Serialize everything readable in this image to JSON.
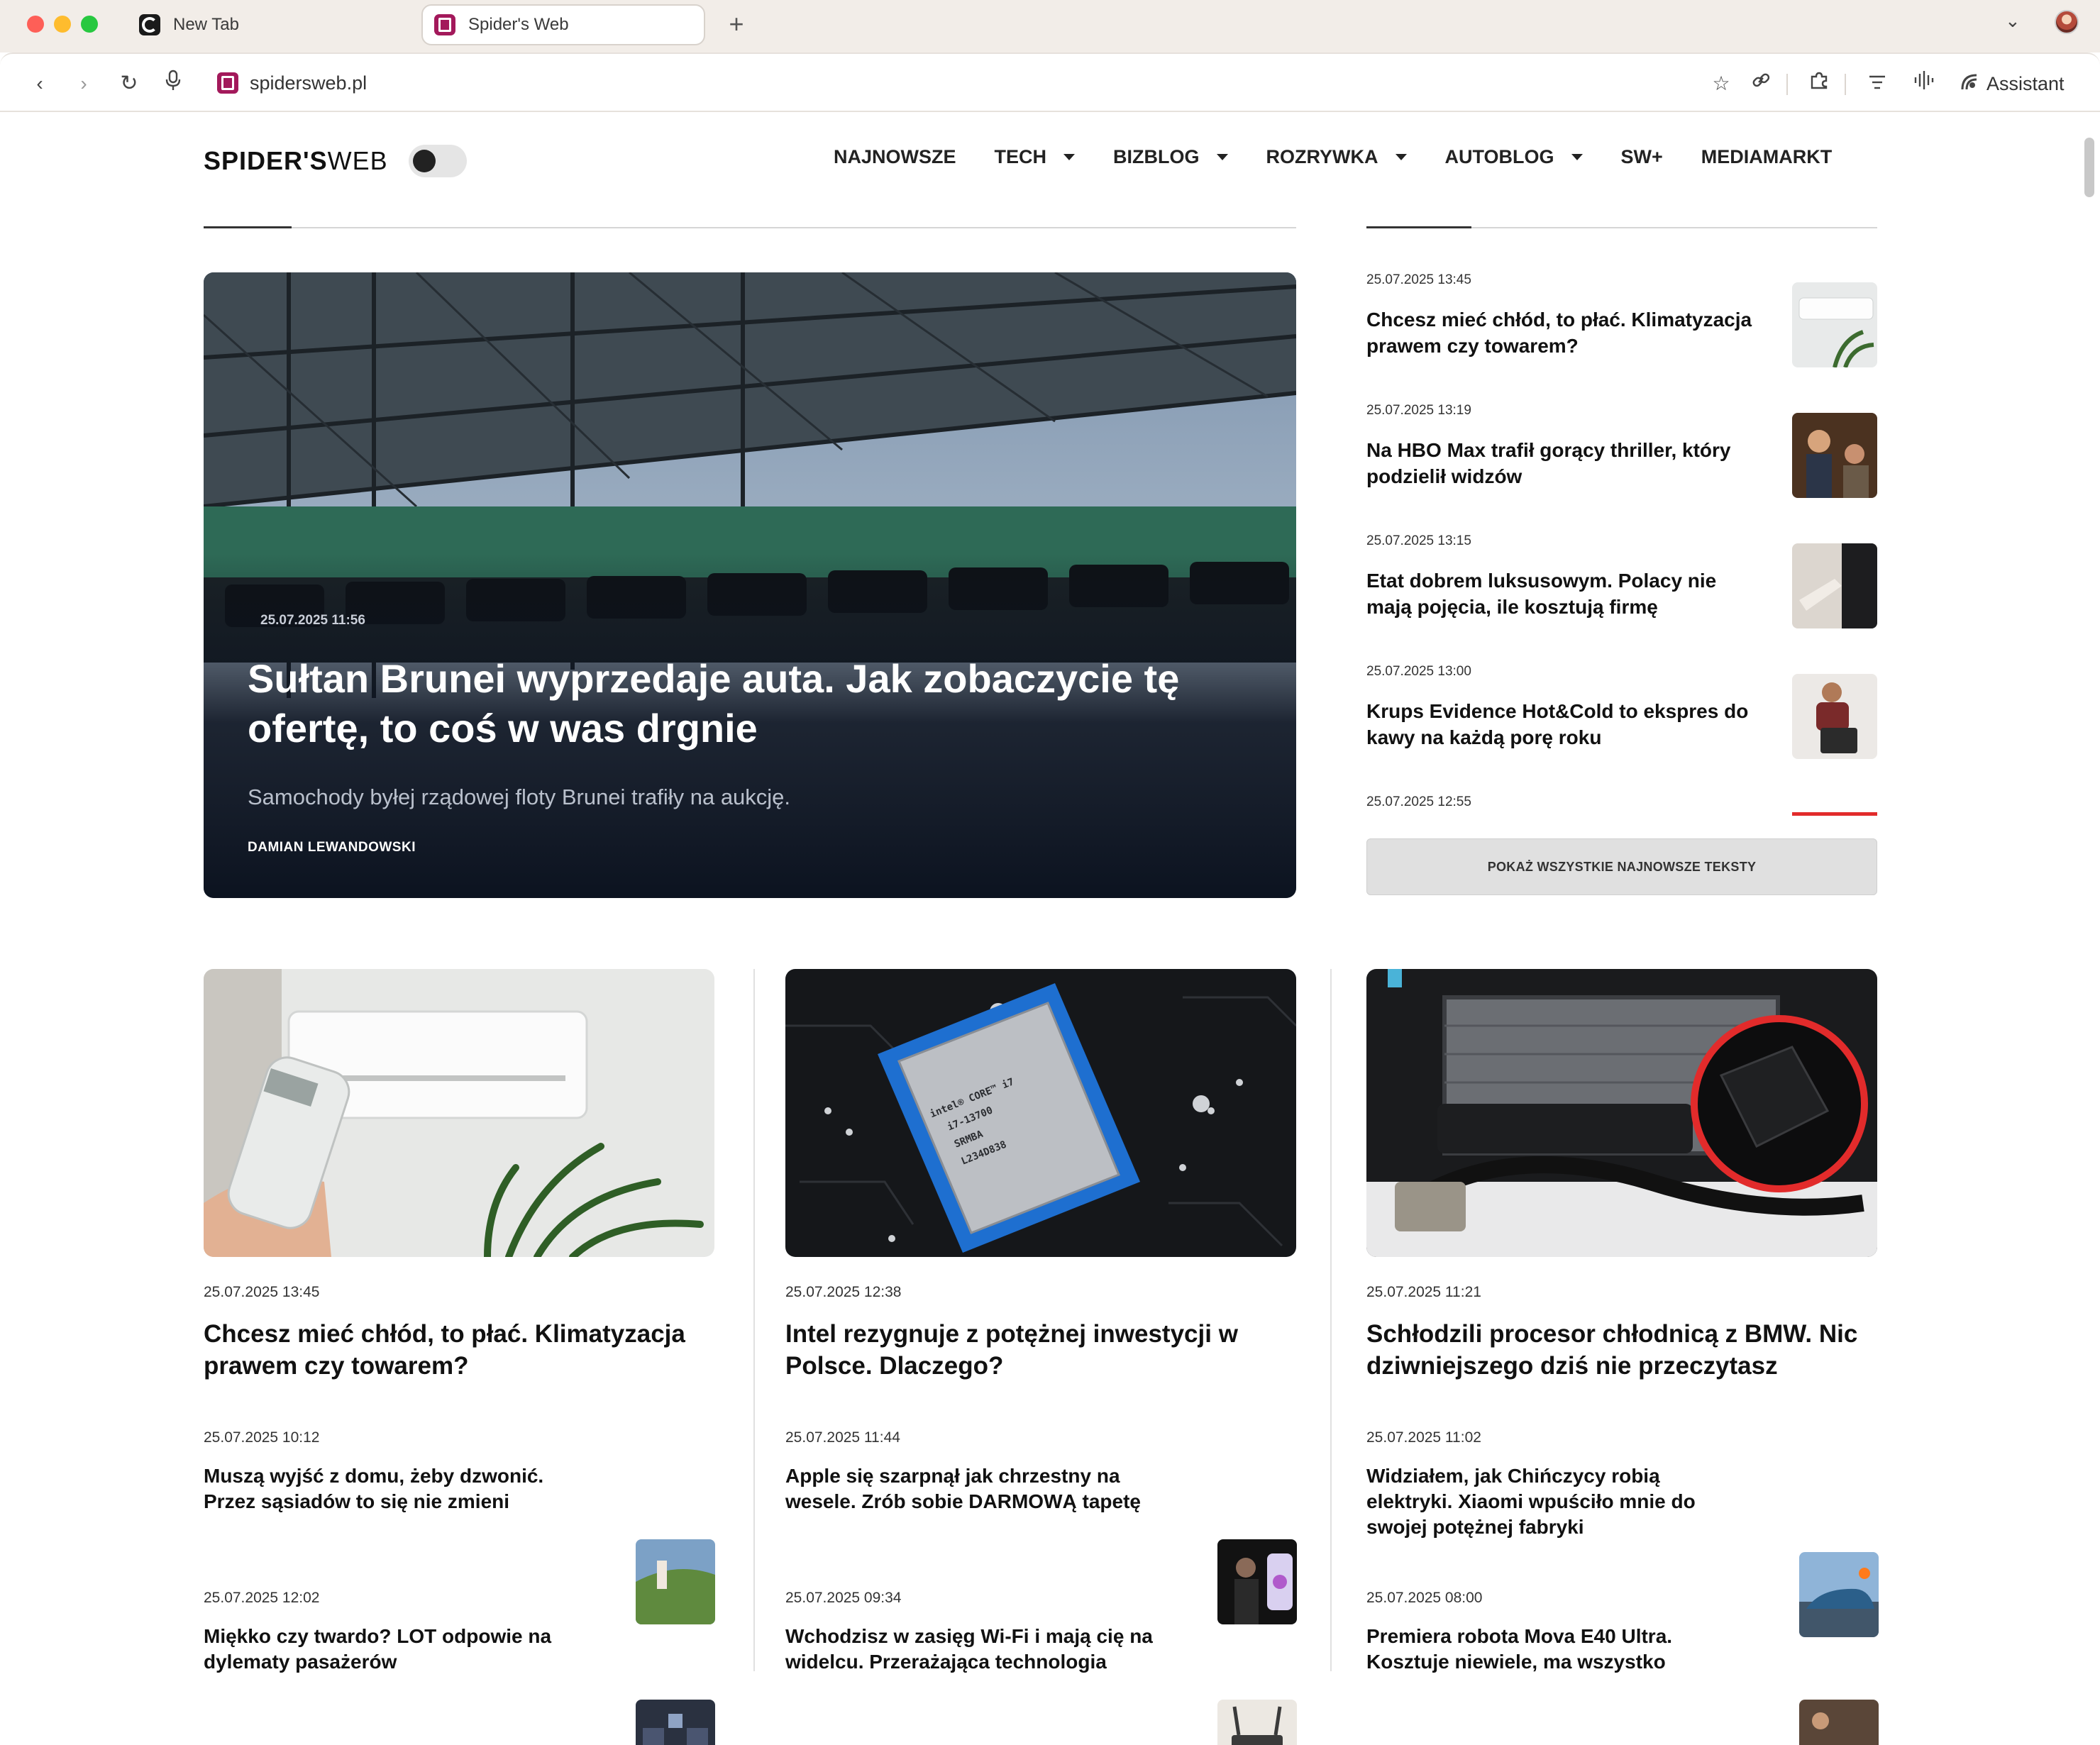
{
  "browser": {
    "tabs": [
      {
        "title": "New Tab",
        "active": false
      },
      {
        "title": "Spider's Web",
        "active": true
      }
    ],
    "url": "spidersweb.pl",
    "assistant_label": "Assistant"
  },
  "site": {
    "logo_bold": "SPIDER'S",
    "logo_light": "WEB",
    "nav": [
      {
        "label": "NAJNOWSZE",
        "dropdown": false
      },
      {
        "label": "TECH",
        "dropdown": true
      },
      {
        "label": "BIZBLOG",
        "dropdown": true
      },
      {
        "label": "ROZRYWKA",
        "dropdown": true
      },
      {
        "label": "AUTOBLOG",
        "dropdown": true
      },
      {
        "label": "SW+",
        "dropdown": false
      },
      {
        "label": "MEDIAMARKT",
        "dropdown": false
      }
    ]
  },
  "hero": {
    "date": "25.07.2025 11:56",
    "title": "Sułtan Brunei wyprzedaje auta. Jak zobaczycie tę ofertę, to coś w was drgnie",
    "lead": "Samochody byłej rządowej floty Brunei trafiły na aukcję.",
    "author": "DAMIAN LEWANDOWSKI"
  },
  "latest": {
    "items": [
      {
        "date": "25.07.2025 13:45",
        "title": "Chcesz mieć chłód, to płać. Klimatyzacja prawem czy towarem?"
      },
      {
        "date": "25.07.2025 13:19",
        "title": "Na HBO Max trafił gorący thriller, który podzielił widzów"
      },
      {
        "date": "25.07.2025 13:15",
        "title": "Etat dobrem luksusowym. Polacy nie mają pojęcia, ile kosztują firmę"
      },
      {
        "date": "25.07.2025 13:00",
        "title": "Krups Evidence Hot&Cold to ekspres do kawy na każdą porę roku"
      },
      {
        "date": "25.07.2025 12:55",
        "title": ""
      }
    ],
    "show_all": "POKAŻ WSZYSTKIE NAJNOWSZE TEKSTY"
  },
  "columns": [
    {
      "main": {
        "date": "25.07.2025 13:45",
        "title": "Chcesz mieć chłód, to płać. Klimatyzacja prawem czy towarem?"
      },
      "items": [
        {
          "date": "25.07.2025 10:12",
          "title": "Muszą wyjść z domu, żeby dzwonić. Przez sąsiadów to się nie zmieni"
        },
        {
          "date": "25.07.2025 12:02",
          "title": "Miękko czy twardo? LOT odpowie na dylematy pasażerów"
        }
      ]
    },
    {
      "main": {
        "date": "25.07.2025 12:38",
        "title": "Intel rezygnuje z potężnej inwestycji w Polsce. Dlaczego?"
      },
      "items": [
        {
          "date": "25.07.2025 11:44",
          "title": "Apple się szarpnął jak chrzestny na wesele. Zrób sobie DARMOWĄ tapetę"
        },
        {
          "date": "25.07.2025 09:34",
          "title": "Wchodzisz w zasięg Wi-Fi i mają cię na widelcu. Przerażająca technologia"
        }
      ]
    },
    {
      "main": {
        "date": "25.07.2025 11:21",
        "title": "Schłodzili procesor chłodnicą z BMW. Nic dziwniejszego dziś nie przeczytasz"
      },
      "items": [
        {
          "date": "25.07.2025 11:02",
          "title": "Widziałem, jak Chińczycy robią elektryki. Xiaomi wpuściło mnie do swojej potężnej fabryki"
        },
        {
          "date": "25.07.2025 08:00",
          "title": "Premiera robota Mova E40 Ultra. Kosztuje niewiele, ma wszystko"
        }
      ]
    }
  ],
  "cpu_label": {
    "line1": "intel® CORE™ i7",
    "line2": "i7-13700",
    "line3": "SRMBA",
    "line4": "L234D838"
  },
  "colors": {
    "brand": "#a3195b",
    "accent_red": "#e22b2b",
    "hero_bg": "#0c1320"
  }
}
